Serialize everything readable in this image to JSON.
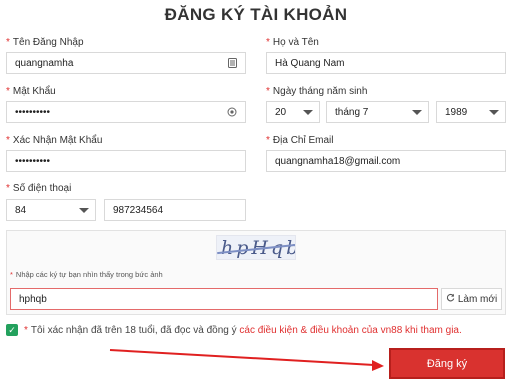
{
  "page": {
    "title": "ĐĂNG KÝ TÀI KHOẢN"
  },
  "form": {
    "username": {
      "label": "Tên Đăng Nhập",
      "value": "quangnamha"
    },
    "fullname": {
      "label": "Họ và Tên",
      "value": "Hà Quang Nam"
    },
    "password": {
      "label": "Mật Khẩu",
      "value": "••••••••••"
    },
    "birthday": {
      "label": "Ngày tháng năm sinh",
      "day": "20",
      "month": "tháng 7",
      "year": "1989"
    },
    "confirm_password": {
      "label": "Xác Nhận Mật Khẩu",
      "value": "••••••••••"
    },
    "email": {
      "label": "Địa Chỉ Email",
      "value": "quangnamha18@gmail.com"
    },
    "phone": {
      "label": "Số điện thoại",
      "country_code": "84",
      "value": "987234564"
    }
  },
  "captcha": {
    "image_text": "hpHqb",
    "prompt": "Nhập các ký tự bạn nhìn thấy trong bức ảnh",
    "value": "hphqb",
    "refresh_label": "Làm mới"
  },
  "agreement": {
    "text_before": "Tôi xác nhận đã trên 18 tuổi, đã đọc và đồng ý ",
    "link_text": "các điều kiện & điều khoản của vn88 khi tham gia."
  },
  "submit": {
    "label": "Đăng ký"
  },
  "colors": {
    "required": "#e03030",
    "submit_bg": "#d9322f",
    "checkbox": "#23a15d",
    "arrow": "#e02020"
  },
  "icons": {
    "username_field": "id-card-icon",
    "password_field": "eye-icon",
    "select": "chevron-down-icon",
    "refresh": "refresh-icon",
    "checkbox": "check-icon"
  }
}
